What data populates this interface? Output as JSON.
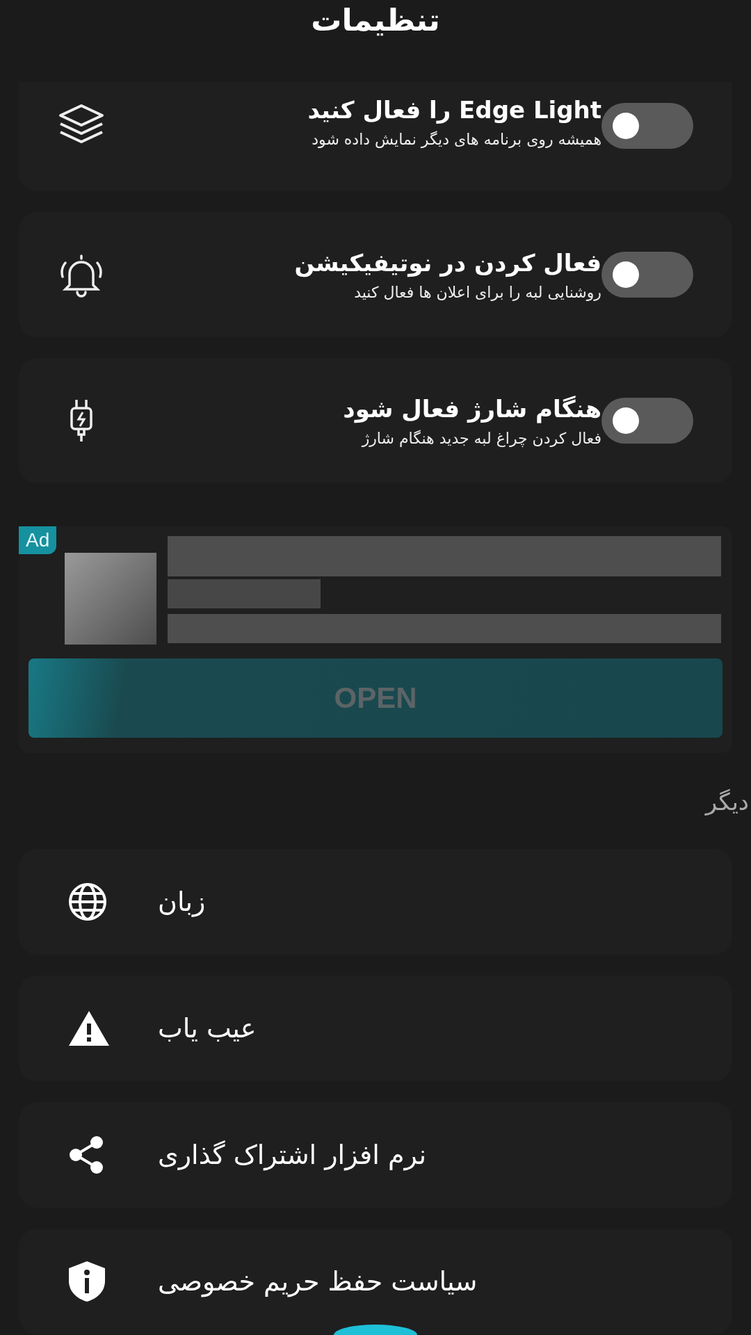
{
  "title": "تنظیمات",
  "toggles": [
    {
      "title": "را فعال کنید Edge Light",
      "subtitle": "همیشه روی برنامه های دیگر نمایش داده شود",
      "on": false
    },
    {
      "title": "فعال کردن در نوتیفیکیشن",
      "subtitle": "روشنایی لبه را برای اعلان ها فعال کنید",
      "on": false
    },
    {
      "title": "هنگام شارژ فعال شود",
      "subtitle": "فعال کردن چراغ لبه جدید هنگام شارژ",
      "on": false
    }
  ],
  "ad": {
    "badge": "Ad",
    "button": "OPEN"
  },
  "section_label": "دیگر",
  "menu": [
    {
      "label": "زبان"
    },
    {
      "label": "عیب یاب"
    },
    {
      "label": "نرم افزار اشتراک گذاری"
    },
    {
      "label": "سیاست حفظ حریم خصوصی"
    }
  ]
}
